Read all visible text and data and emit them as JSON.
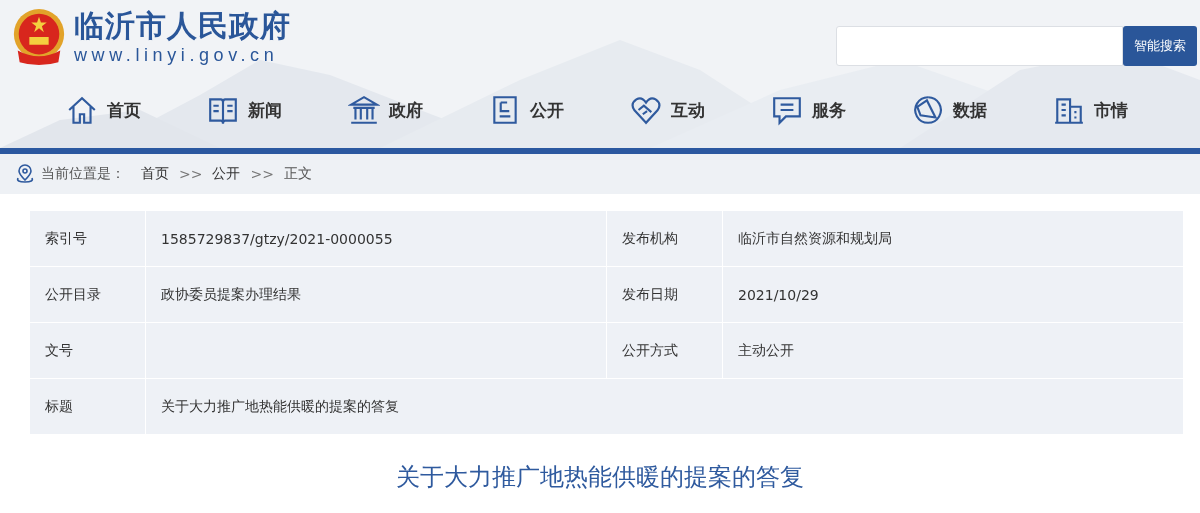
{
  "site": {
    "name": "临沂市人民政府",
    "url": "www.linyi.gov.cn"
  },
  "search": {
    "button": "智能搜索"
  },
  "nav": [
    {
      "label": "首页"
    },
    {
      "label": "新闻"
    },
    {
      "label": "政府"
    },
    {
      "label": "公开"
    },
    {
      "label": "互动"
    },
    {
      "label": "服务"
    },
    {
      "label": "数据"
    },
    {
      "label": "市情"
    }
  ],
  "breadcrumb": {
    "label": "当前位置是：",
    "items": [
      {
        "text": "首页",
        "kind": "link"
      },
      {
        "text": ">>",
        "kind": "separator"
      },
      {
        "text": "公开",
        "kind": "link"
      },
      {
        "text": ">>",
        "kind": "separator"
      },
      {
        "text": "正文",
        "kind": "current"
      }
    ]
  },
  "info_table": [
    {
      "cells": [
        "索引号",
        "1585729837/gtzy/2021-0000055",
        "发布机构",
        "临沂市自然资源和规划局"
      ]
    },
    {
      "cells": [
        "公开目录",
        "政协委员提案办理结果",
        "发布日期",
        "2021/10/29"
      ]
    },
    {
      "cells": [
        "文号",
        "",
        "公开方式",
        "主动公开"
      ]
    },
    {
      "cells": [
        "标题",
        "关于大力推广地热能供暖的提案的答复"
      ]
    }
  ],
  "article": {
    "title": "关于大力推广地热能供暖的提案的答复"
  }
}
